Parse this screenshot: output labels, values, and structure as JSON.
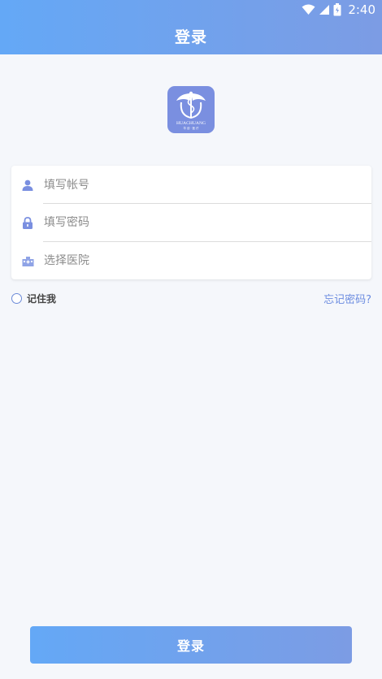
{
  "status_bar": {
    "time": "2:40"
  },
  "header": {
    "title": "登录"
  },
  "logo": {
    "line1": "HUACHUANG",
    "line2": "华 创 · 医 疗"
  },
  "form": {
    "account_placeholder": "填写帐号",
    "password_placeholder": "填写密码",
    "hospital_placeholder": "选择医院"
  },
  "options": {
    "remember_label": "记住我",
    "forgot_label": "忘记密码?"
  },
  "login_button": {
    "label": "登录"
  },
  "colors": {
    "accent": "#64a8f6",
    "accent_end": "#7c9ce4",
    "link": "#6c8ce0"
  }
}
